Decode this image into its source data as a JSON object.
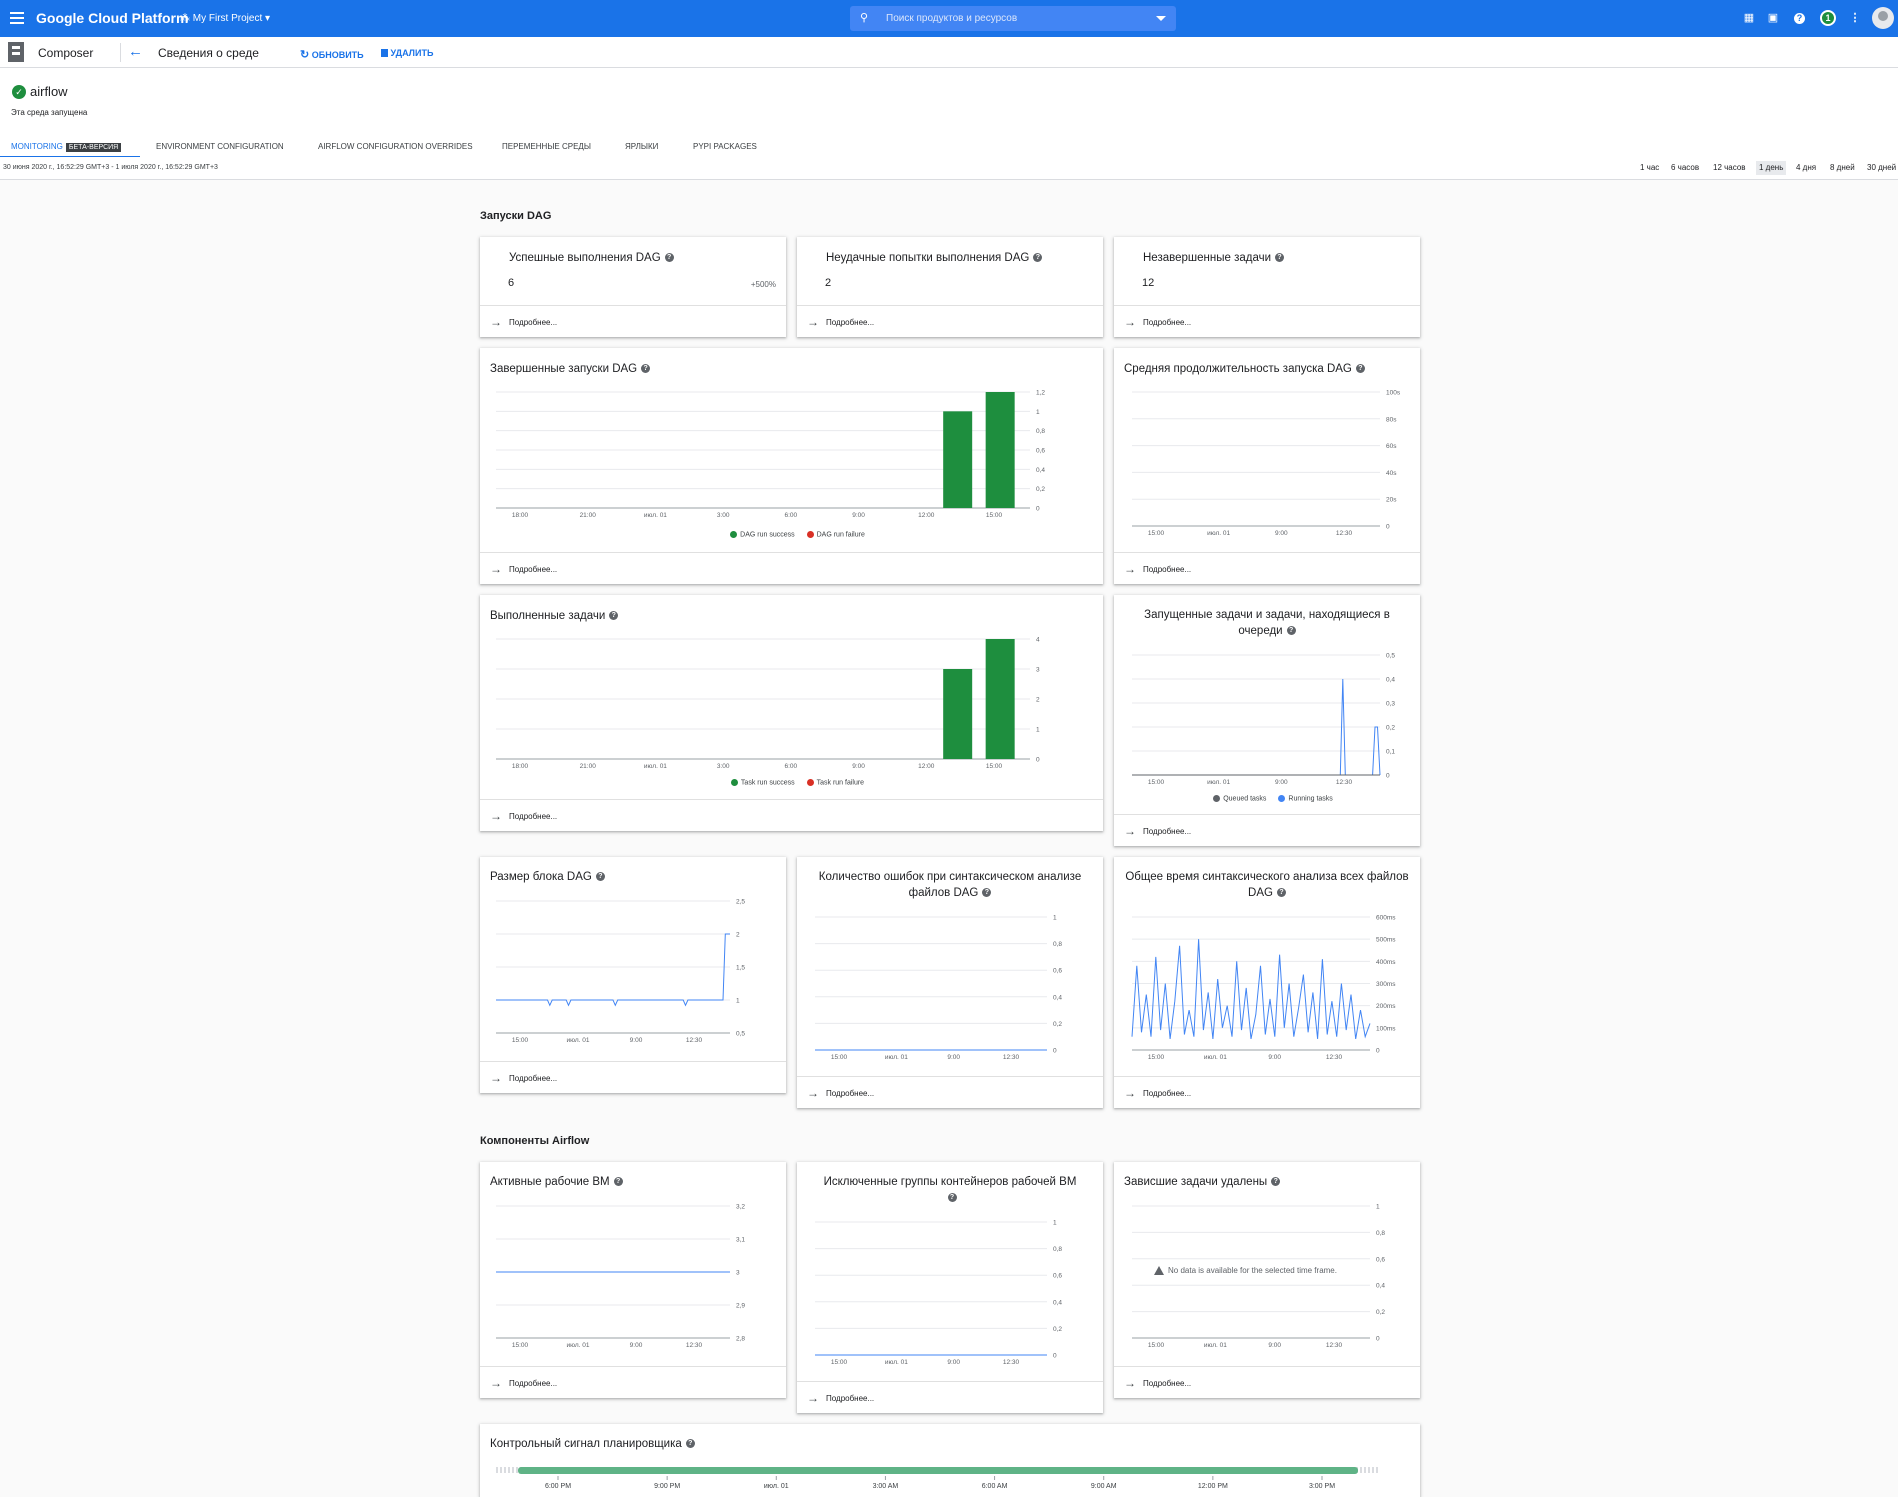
{
  "topbar": {
    "brand": "Google Cloud Platform",
    "project": "My First Project",
    "search_placeholder": "Поиск продуктов и ресурсов",
    "notification_count": "1"
  },
  "subbar": {
    "product": "Composer",
    "page_title": "Сведения о среде",
    "refresh_label": "ОБНОВИТЬ",
    "delete_label": "УДАЛИТЬ"
  },
  "environment": {
    "name": "airflow",
    "status": "Эта среда запущена"
  },
  "tabs": [
    {
      "label": "MONITORING",
      "badge": "БЕТА-ВЕРСИЯ"
    },
    {
      "label": "ENVIRONMENT CONFIGURATION"
    },
    {
      "label": "AIRFLOW CONFIGURATION OVERRIDES"
    },
    {
      "label": "ПЕРЕМЕННЫЕ СРЕДЫ"
    },
    {
      "label": "ЯРЛЫКИ"
    },
    {
      "label": "PYPI PACKAGES"
    }
  ],
  "time_range": {
    "text": "30 июня 2020 г., 16:52:29 GMT+3 - 1 июля 2020 г., 16:52:29 GMT+3",
    "options": [
      "1 час",
      "6 часов",
      "12 часов",
      "1 день",
      "4 дня",
      "8 дней",
      "30 дней"
    ],
    "selected": "1 день"
  },
  "sections": {
    "dag_runs": "Запуски DAG",
    "components": "Компоненты Airflow"
  },
  "more_link": "Подробнее...",
  "cards": {
    "success": {
      "title": "Успешные выполнения DAG",
      "value": "6",
      "delta": "+500%"
    },
    "failed": {
      "title": "Неудачные попытки выполнения DAG",
      "value": "2"
    },
    "unfinished": {
      "title": "Незавершенные задачи",
      "value": "12"
    },
    "completed_runs": {
      "title": "Завершенные запуски DAG",
      "legend": [
        "DAG run success",
        "DAG run failure"
      ]
    },
    "avg_duration": {
      "title": "Средняя продолжительность запуска DAG"
    },
    "tasks_done": {
      "title": "Выполненные задачи",
      "legend": [
        "Task run success",
        "Task run failure"
      ]
    },
    "running_queued": {
      "title": "Запущенные задачи и задачи, находящиеся в очереди",
      "legend": [
        "Queued tasks",
        "Running tasks"
      ]
    },
    "dagbag": {
      "title": "Размер блока DAG"
    },
    "parse_errors": {
      "title": "Количество ошибок при синтаксическом анализе файлов DAG"
    },
    "parse_time": {
      "title": "Общее время синтаксического анализа всех файлов DAG"
    },
    "workers": {
      "title": "Активные рабочие ВМ"
    },
    "evicted": {
      "title": "Исключенные группы контейнеров рабочей ВМ"
    },
    "zombies": {
      "title": "Зависшие задачи удалены",
      "nodata": "No data is available for the selected time frame."
    },
    "heartbeat": {
      "title": "Контрольный сигнал планировщика"
    }
  },
  "colors": {
    "brand": "#1a73e8",
    "success": "#1e8e3e",
    "failure": "#d93025",
    "series": "#4285f4",
    "queued": "#5f6368",
    "heartbeat": "#5fb386"
  },
  "chart_data": [
    {
      "id": "completed_runs",
      "type": "bar",
      "categories": [
        "15:00",
        "18:00",
        "21:00",
        "июл. 01",
        "3:00",
        "6:00",
        "9:00",
        "12:00",
        "15:00"
      ],
      "x_ticks": [
        "18:00",
        "21:00",
        "июл. 01",
        "3:00",
        "6:00",
        "9:00",
        "12:00",
        "15:00"
      ],
      "y_ticks": [
        "0",
        "0,2",
        "0,4",
        "0,6",
        "0,8",
        "1",
        "1,2"
      ],
      "ylim": [
        0,
        1.2
      ],
      "bars": [
        {
          "series": "DAG run success",
          "slot": 7.6,
          "value": 1
        },
        {
          "series": "DAG run success",
          "slot": 8.3,
          "value": 1.2
        }
      ],
      "series": [
        {
          "name": "DAG run success"
        },
        {
          "name": "DAG run failure"
        }
      ]
    },
    {
      "id": "avg_duration",
      "type": "line",
      "x_ticks": [
        "15:00",
        "июл. 01",
        "9:00",
        "12:30"
      ],
      "y_ticks": [
        "0",
        "20s",
        "40s",
        "60s",
        "80s",
        "100s"
      ],
      "ylim": [
        0,
        100
      ]
    },
    {
      "id": "tasks_done",
      "type": "bar",
      "x_ticks": [
        "18:00",
        "21:00",
        "июл. 01",
        "3:00",
        "6:00",
        "9:00",
        "12:00",
        "15:00"
      ],
      "y_ticks": [
        "0",
        "1",
        "2",
        "3",
        "4"
      ],
      "ylim": [
        0,
        4
      ],
      "bars": [
        {
          "series": "Task run success",
          "slot": 7.6,
          "value": 3
        },
        {
          "series": "Task run success",
          "slot": 8.3,
          "value": 4
        }
      ],
      "series": [
        {
          "name": "Task run success"
        },
        {
          "name": "Task run failure"
        }
      ]
    },
    {
      "id": "running_queued",
      "type": "line",
      "x_ticks": [
        "15:00",
        "июл. 01",
        "9:00",
        "12:30"
      ],
      "y_ticks": [
        "0",
        "0,1",
        "0,2",
        "0,3",
        "0,4",
        "0,5"
      ],
      "ylim": [
        0,
        0.5
      ],
      "series": [
        {
          "name": "Running tasks",
          "points": [
            [
              0,
              0
            ],
            [
              0.84,
              0
            ],
            [
              0.85,
              0.4
            ],
            [
              0.86,
              0
            ],
            [
              0.97,
              0
            ],
            [
              0.98,
              0.2
            ],
            [
              0.99,
              0.2
            ],
            [
              1,
              0
            ]
          ]
        },
        {
          "name": "Queued tasks",
          "points": [
            [
              0,
              0
            ],
            [
              1,
              0
            ]
          ]
        }
      ]
    },
    {
      "id": "dagbag",
      "type": "line",
      "x_ticks": [
        "15:00",
        "июл. 01",
        "9:00",
        "12:30"
      ],
      "y_ticks": [
        "0,5",
        "1",
        "1,5",
        "2",
        "2,5"
      ],
      "ylim": [
        0.5,
        2.5
      ],
      "series": [
        {
          "name": "",
          "points": [
            [
              0,
              1
            ],
            [
              0.22,
              1
            ],
            [
              0.23,
              0.92
            ],
            [
              0.24,
              1
            ],
            [
              0.3,
              1
            ],
            [
              0.31,
              0.92
            ],
            [
              0.32,
              1
            ],
            [
              0.5,
              1
            ],
            [
              0.51,
              0.92
            ],
            [
              0.52,
              1
            ],
            [
              0.8,
              1
            ],
            [
              0.81,
              0.92
            ],
            [
              0.82,
              1
            ],
            [
              0.97,
              1
            ],
            [
              0.98,
              2
            ],
            [
              1,
              2
            ]
          ]
        }
      ]
    },
    {
      "id": "parse_errors",
      "type": "line",
      "x_ticks": [
        "15:00",
        "июл. 01",
        "9:00",
        "12:30"
      ],
      "y_ticks": [
        "0",
        "0,2",
        "0,4",
        "0,6",
        "0,8",
        "1"
      ],
      "ylim": [
        0,
        1
      ],
      "series": [
        {
          "name": "",
          "points": [
            [
              0,
              0
            ],
            [
              1,
              0
            ]
          ]
        }
      ]
    },
    {
      "id": "parse_time",
      "type": "line",
      "x_ticks": [
        "15:00",
        "июл. 01",
        "9:00",
        "12:30"
      ],
      "y_ticks": [
        "0",
        "100ms",
        "200ms",
        "300ms",
        "400ms",
        "500ms",
        "600ms"
      ],
      "ylim": [
        0,
        600
      ],
      "series": [
        {
          "name": "",
          "points": [
            [
              0,
              60
            ],
            [
              0.02,
              380
            ],
            [
              0.04,
              80
            ],
            [
              0.06,
              250
            ],
            [
              0.08,
              60
            ],
            [
              0.1,
              420
            ],
            [
              0.12,
              90
            ],
            [
              0.14,
              300
            ],
            [
              0.16,
              50
            ],
            [
              0.18,
              220
            ],
            [
              0.2,
              470
            ],
            [
              0.22,
              70
            ],
            [
              0.24,
              180
            ],
            [
              0.26,
              60
            ],
            [
              0.28,
              500
            ],
            [
              0.3,
              90
            ],
            [
              0.32,
              260
            ],
            [
              0.34,
              50
            ],
            [
              0.36,
              320
            ],
            [
              0.38,
              100
            ],
            [
              0.4,
              200
            ],
            [
              0.42,
              60
            ],
            [
              0.44,
              400
            ],
            [
              0.46,
              90
            ],
            [
              0.48,
              280
            ],
            [
              0.5,
              50
            ],
            [
              0.52,
              160
            ],
            [
              0.54,
              380
            ],
            [
              0.56,
              70
            ],
            [
              0.58,
              230
            ],
            [
              0.6,
              60
            ],
            [
              0.62,
              430
            ],
            [
              0.64,
              100
            ],
            [
              0.66,
              300
            ],
            [
              0.68,
              60
            ],
            [
              0.7,
              190
            ],
            [
              0.72,
              340
            ],
            [
              0.74,
              80
            ],
            [
              0.76,
              260
            ],
            [
              0.78,
              50
            ],
            [
              0.8,
              410
            ],
            [
              0.82,
              70
            ],
            [
              0.84,
              220
            ],
            [
              0.86,
              60
            ],
            [
              0.88,
              300
            ],
            [
              0.9,
              90
            ],
            [
              0.92,
              250
            ],
            [
              0.94,
              50
            ],
            [
              0.96,
              180
            ],
            [
              0.98,
              60
            ],
            [
              1,
              120
            ]
          ]
        }
      ]
    },
    {
      "id": "workers",
      "type": "line",
      "x_ticks": [
        "15:00",
        "июл. 01",
        "9:00",
        "12:30"
      ],
      "y_ticks": [
        "2,8",
        "2,9",
        "3",
        "3,1",
        "3,2"
      ],
      "ylim": [
        2.8,
        3.2
      ],
      "series": [
        {
          "name": "",
          "points": [
            [
              0,
              3
            ],
            [
              1,
              3
            ]
          ]
        }
      ]
    },
    {
      "id": "evicted",
      "type": "line",
      "x_ticks": [
        "15:00",
        "июл. 01",
        "9:00",
        "12:30"
      ],
      "y_ticks": [
        "0",
        "0,2",
        "0,4",
        "0,6",
        "0,8",
        "1"
      ],
      "ylim": [
        0,
        1
      ],
      "series": [
        {
          "name": "",
          "points": [
            [
              0,
              0
            ],
            [
              1,
              0
            ]
          ]
        }
      ]
    },
    {
      "id": "zombies",
      "type": "line",
      "x_ticks": [
        "15:00",
        "июл. 01",
        "9:00",
        "12:30"
      ],
      "y_ticks": [
        "0",
        "0,2",
        "0,4",
        "0,6",
        "0,8",
        "1"
      ],
      "ylim": [
        0,
        1
      ],
      "series": []
    },
    {
      "id": "heartbeat",
      "type": "area",
      "x_ticks": [
        "6:00 PM",
        "9:00 PM",
        "июл. 01",
        "3:00 AM",
        "6:00 AM",
        "9:00 AM",
        "12:00 PM",
        "3:00 PM"
      ]
    }
  ]
}
